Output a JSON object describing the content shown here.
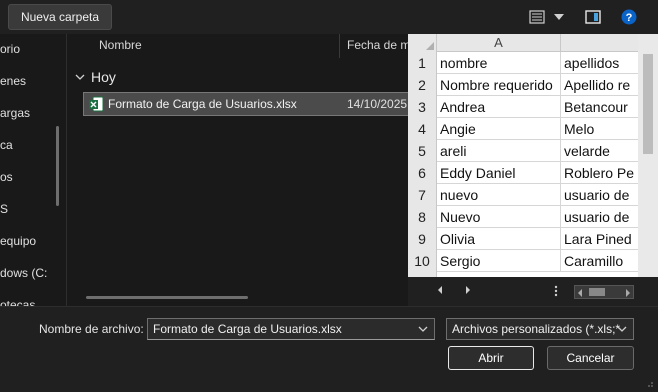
{
  "toolbar": {
    "new_folder_label": "Nueva carpeta",
    "icons": [
      "view-menu-icon",
      "chevron-down-icon",
      "preview-pane-icon",
      "help-icon"
    ],
    "help_glyph": "?"
  },
  "nav": {
    "items": [
      "orio",
      "enes",
      "argas",
      "ca",
      "os",
      "S",
      "equipo",
      "dows (C:",
      "otecas"
    ]
  },
  "list": {
    "col_name": "Nombre",
    "col_date": "Fecha de m",
    "group": "Hoy",
    "files": [
      {
        "name": "Formato de Carga de Usuarios.xlsx",
        "date": "14/10/2025",
        "icon": "excel-icon"
      }
    ]
  },
  "preview": {
    "column_header": "A",
    "rows": [
      {
        "n": "1",
        "a": "nombre",
        "b": "apellidos"
      },
      {
        "n": "2",
        "a": "Nombre requerido",
        "b": "Apellido re"
      },
      {
        "n": "3",
        "a": "Andrea",
        "b": "Betancour"
      },
      {
        "n": "4",
        "a": "Angie",
        "b": "Melo"
      },
      {
        "n": "5",
        "a": "areli",
        "b": "velarde"
      },
      {
        "n": "6",
        "a": "Eddy Daniel",
        "b": "Roblero Pe"
      },
      {
        "n": "7",
        "a": "nuevo",
        "b": "usuario de"
      },
      {
        "n": "8",
        "a": "Nuevo",
        "b": "usuario de"
      },
      {
        "n": "9",
        "a": "Olivia",
        "b": "Lara Pined"
      },
      {
        "n": "10",
        "a": "Sergio",
        "b": "Caramillo"
      }
    ]
  },
  "footer": {
    "filename_label": "Nombre de archivo:",
    "filename_value": "Formato de Carga de Usuarios.xlsx",
    "filetype_value": "Archivos personalizados (*.xls;*",
    "open_label": "Abrir",
    "cancel_label": "Cancelar"
  },
  "colors": {
    "background": "#191919",
    "selected_row": "#4b4b4b",
    "help_blue": "#0a64c8",
    "excel_green": "#1d6f42"
  }
}
